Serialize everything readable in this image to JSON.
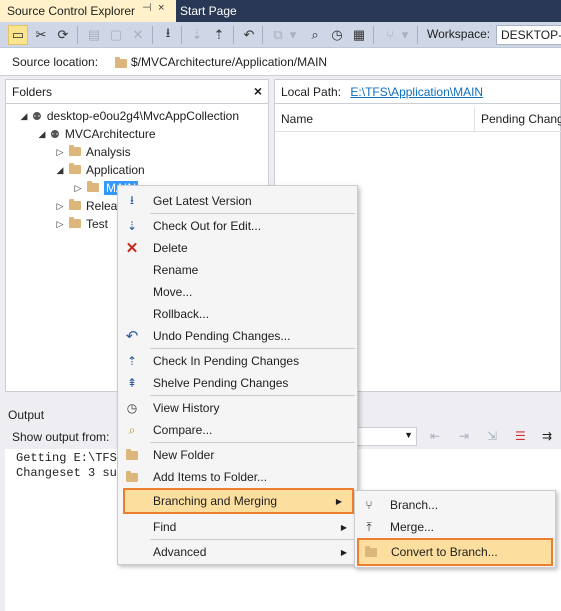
{
  "tabs": [
    {
      "label": "Source Control Explorer",
      "pin": "⊣",
      "close": "×"
    },
    {
      "label": "Start Page"
    }
  ],
  "toolbar": {
    "workspace_label": "Workspace:",
    "workspace_value": "DESKTOP-E"
  },
  "location": {
    "label": "Source location:",
    "path": "$/MVCArchitecture/Application/MAIN"
  },
  "folders": {
    "title": "Folders",
    "close": "×",
    "tree": [
      {
        "label": "desktop-e0ou2g4\\MvcAppCollection"
      },
      {
        "label": "MVCArchitecture"
      },
      {
        "label": "Analysis"
      },
      {
        "label": "Application"
      },
      {
        "label": "MAIN"
      },
      {
        "label": "Release"
      },
      {
        "label": "Test"
      }
    ]
  },
  "details": {
    "local_path_label": "Local Path:",
    "local_path": "E:\\TFS\\Application\\MAIN",
    "columns": [
      "Name",
      "Pending Change"
    ]
  },
  "output": {
    "title": "Output",
    "show_from_label": "Show output from:",
    "lines": [
      "Getting E:\\TFS",
      "Changeset 3 su"
    ]
  },
  "context_menu": {
    "items": [
      {
        "label": "Get Latest Version",
        "icon": "get-latest-icon"
      },
      {
        "label": "Check Out for Edit...",
        "icon": "check-out-icon"
      },
      {
        "label": "Delete",
        "icon": "delete-icon"
      },
      {
        "label": "Rename"
      },
      {
        "label": "Move..."
      },
      {
        "label": "Rollback..."
      },
      {
        "label": "Undo Pending Changes...",
        "icon": "undo-icon"
      },
      {
        "label": "Check In Pending Changes",
        "icon": "check-in-icon"
      },
      {
        "label": "Shelve Pending Changes",
        "icon": "shelve-icon"
      },
      {
        "label": "View History",
        "icon": "history-icon"
      },
      {
        "label": "Compare...",
        "icon": "compare-icon"
      },
      {
        "label": "New Folder",
        "icon": "new-folder-icon"
      },
      {
        "label": "Add Items to Folder...",
        "icon": "add-items-icon"
      },
      {
        "label": "Branching and Merging",
        "submenu": true
      },
      {
        "label": "Find",
        "submenu": true
      },
      {
        "label": "Advanced",
        "submenu": true
      }
    ]
  },
  "submenu": {
    "items": [
      {
        "label": "Branch...",
        "icon": "branch-icon"
      },
      {
        "label": "Merge...",
        "icon": "merge-icon"
      },
      {
        "label": "Convert to Branch...",
        "icon": "convert-to-branch-icon"
      }
    ]
  },
  "colors": {
    "highlight_border": "#ed7d31",
    "highlight_fill": "#fcdf9e",
    "link": "#0e70c0",
    "title_bar": "#293955"
  }
}
